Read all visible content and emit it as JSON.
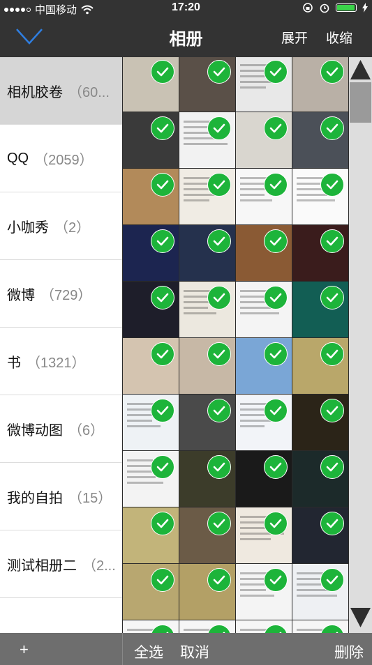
{
  "status_bar": {
    "carrier": "中国移动",
    "time": "17:20",
    "signal_dots": 5,
    "signal_filled": 4,
    "battery_level": 0.95,
    "battery_color": "#3bd24a"
  },
  "nav": {
    "title": "相册",
    "expand_label": "展开",
    "collapse_label": "收缩",
    "back_icon": "chevron-down-icon"
  },
  "albums": [
    {
      "name": "相机胶卷",
      "count": "（60..."
    },
    {
      "name": "QQ",
      "count": "（2059）"
    },
    {
      "name": "小咖秀",
      "count": "（2）"
    },
    {
      "name": "微博",
      "count": "（729）"
    },
    {
      "name": "书",
      "count": "（1321）"
    },
    {
      "name": "微博动图",
      "count": "（6）"
    },
    {
      "name": "我的自拍",
      "count": "（15）"
    },
    {
      "name": "测试相册二",
      "count": "（2..."
    }
  ],
  "photos": [
    {
      "bg": "#c9c2b4",
      "selected": true
    },
    {
      "bg": "#5a5048",
      "selected": true
    },
    {
      "bg": "#e8e8e8",
      "selected": true
    },
    {
      "bg": "#b9b0a6",
      "selected": true
    },
    {
      "bg": "#3a3a3a",
      "selected": true
    },
    {
      "bg": "#f2f2f2",
      "selected": true
    },
    {
      "bg": "#d9d6cf",
      "selected": true
    },
    {
      "bg": "#4b5058",
      "selected": true
    },
    {
      "bg": "#b28a5a",
      "selected": true
    },
    {
      "bg": "#f0ece4",
      "selected": true
    },
    {
      "bg": "#f7f7f7",
      "selected": true
    },
    {
      "bg": "#fafafa",
      "selected": true
    },
    {
      "bg": "#1c2550",
      "selected": true
    },
    {
      "bg": "#25314d",
      "selected": true
    },
    {
      "bg": "#8a5a34",
      "selected": true
    },
    {
      "bg": "#3a1c1c",
      "selected": true
    },
    {
      "bg": "#1e1e2a",
      "selected": true
    },
    {
      "bg": "#ece8df",
      "selected": true
    },
    {
      "bg": "#f4f4f4",
      "selected": true
    },
    {
      "bg": "#125e54",
      "selected": true
    },
    {
      "bg": "#d4c4b0",
      "selected": true
    },
    {
      "bg": "#c7b8a6",
      "selected": true
    },
    {
      "bg": "#7aa6d6",
      "selected": true
    },
    {
      "bg": "#b9a76a",
      "selected": true
    },
    {
      "bg": "#eef2f5",
      "selected": true
    },
    {
      "bg": "#4a4a4a",
      "selected": true
    },
    {
      "bg": "#f2f4f8",
      "selected": true
    },
    {
      "bg": "#2b2418",
      "selected": true
    },
    {
      "bg": "#f3f3f3",
      "selected": true
    },
    {
      "bg": "#3c3c2a",
      "selected": true
    },
    {
      "bg": "#1a1a1a",
      "selected": true
    },
    {
      "bg": "#1c2a2a",
      "selected": true
    },
    {
      "bg": "#c2b47a",
      "selected": true
    },
    {
      "bg": "#6b5b47",
      "selected": true
    },
    {
      "bg": "#efe9e0",
      "selected": true
    },
    {
      "bg": "#222631",
      "selected": true
    },
    {
      "bg": "#b8a770",
      "selected": true
    },
    {
      "bg": "#b3a066",
      "selected": true
    },
    {
      "bg": "#f4f4f4",
      "selected": true
    },
    {
      "bg": "#eef0f3",
      "selected": true
    },
    {
      "bg": "#f6f6f6",
      "selected": true
    },
    {
      "bg": "#f6f6f6",
      "selected": true
    },
    {
      "bg": "#f6f6f6",
      "selected": true
    },
    {
      "bg": "#f6f6f6",
      "selected": true
    }
  ],
  "scrollbar": {
    "position": 0.0
  },
  "bottom_bar": {
    "add_label": "+",
    "select_all_label": "全选",
    "cancel_label": "取消",
    "delete_label": "删除"
  }
}
